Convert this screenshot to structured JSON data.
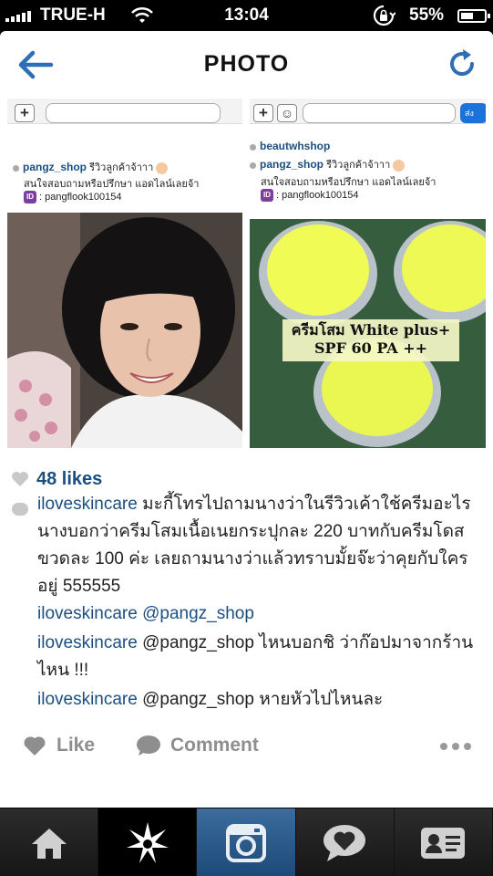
{
  "status_bar": {
    "carrier": "TRUE-H",
    "time": "13:04",
    "battery": "55%",
    "battery_level": 0.55
  },
  "header": {
    "title": "PHOTO"
  },
  "photo": {
    "left_panel": {
      "username": "pangz_shop",
      "caption": "รีวิวลูกค้าจ้าาา",
      "line2": "สนใจสอบถามหรือปรึกษา แอดไลน์เลยจ้า",
      "line_id": ": pangflook100154"
    },
    "right_panel": {
      "top_user": "beautwhshop",
      "username": "pangz_shop",
      "caption": "รีวิวลูกค้าจ้าาา",
      "line2": "สนใจสอบถามหรือปรึกษา แอดไลน์เลยจ้า",
      "line_id": ": pangflook100154",
      "product_label_line1": "ครีมโสม White plus+",
      "product_label_line2": "SPF 60 PA ++",
      "send_label": "ส่ง"
    }
  },
  "likes": "48 likes",
  "comments": [
    {
      "user": "iloveskincare",
      "text": " มะกี้โทรไปถามนางว่าในรีวิวเค้าใช้ครีมอะไร นางบอกว่าครีมโสมเนื้อเนยกระปุกละ 220 บาทกับครีมโดสขวดละ 100 ค่ะ เลยถามนางว่าแล้วทราบมั้ยจ๊ะว่าคุยกับใครอยู่ 555555"
    },
    {
      "user": "iloveskincare",
      "text": " @pangz_shop"
    },
    {
      "user": "iloveskincare",
      "text": " @pangz_shop ไหนบอกชิ ว่าก๊อปมาจากร้านไหน !!!"
    },
    {
      "user": "iloveskincare",
      "text": " @pangz_shop หายหัวไปไหนละ"
    }
  ],
  "actions": {
    "like": "Like",
    "comment": "Comment"
  },
  "tabs": [
    "home",
    "explore",
    "camera",
    "activity",
    "profile"
  ],
  "colors": {
    "link": "#1b4f82",
    "accent": "#2f6db5",
    "tab_active": "#2b5f92"
  }
}
